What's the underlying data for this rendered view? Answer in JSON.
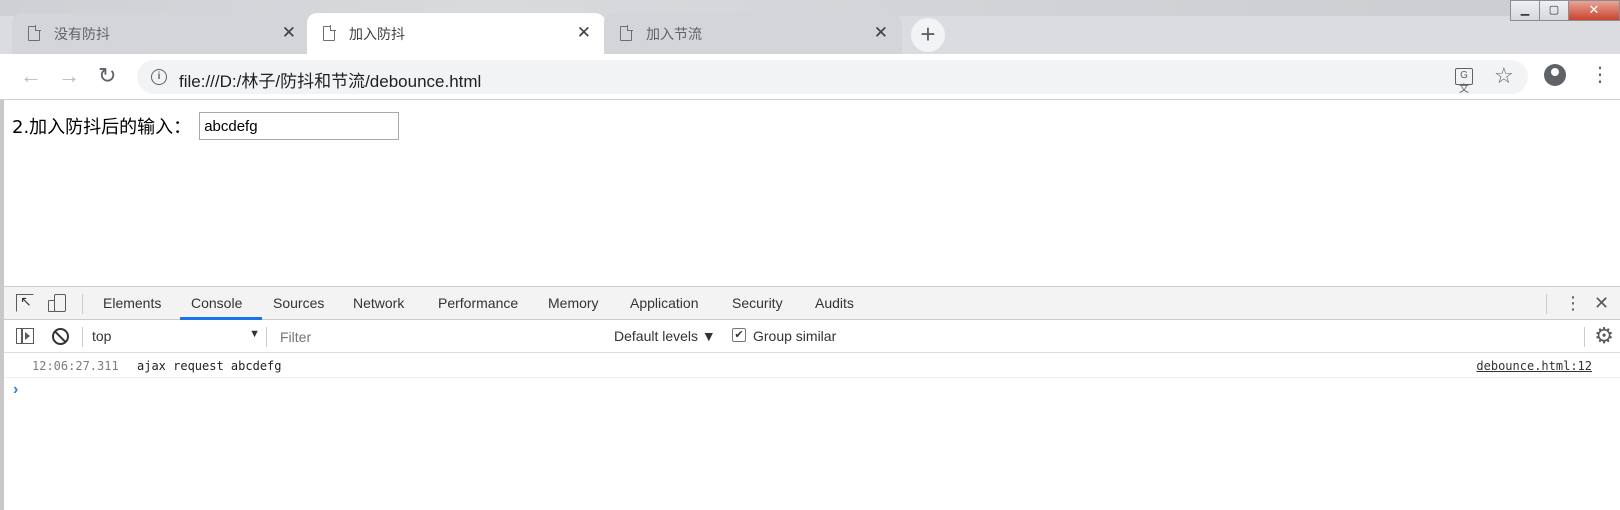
{
  "browser": {
    "tabs": [
      {
        "label": "没有防抖",
        "active": false
      },
      {
        "label": "加入防抖",
        "active": true
      },
      {
        "label": "加入节流",
        "active": false
      }
    ],
    "tab_close_glyph": "✕",
    "new_tab_glyph": "+",
    "window_buttons": {
      "minimize": "▁",
      "maximize": "▢",
      "close": "✕"
    },
    "nav": {
      "back": "←",
      "forward": "→",
      "reload": "↻"
    },
    "address": "file:///D:/林子/防抖和节流/debounce.html",
    "info_glyph": "i",
    "translate_glyph": "G文",
    "star_glyph": "☆",
    "menu_glyph": "⋮"
  },
  "page": {
    "label": "2.加入防抖后的输入：",
    "input_value": "abcdefg"
  },
  "devtools": {
    "tabs": [
      "Elements",
      "Console",
      "Sources",
      "Network",
      "Performance",
      "Memory",
      "Application",
      "Security",
      "Audits"
    ],
    "selected_tab": "Console",
    "more_glyph": "⋮",
    "close_glyph": "✕",
    "context": "top",
    "context_arrow": "▼",
    "filter_placeholder": "Filter",
    "levels": "Default levels ▼",
    "group_similar": "Group similar",
    "group_similar_checked": true,
    "check_glyph": "✔",
    "settings_glyph": "⚙",
    "messages": [
      {
        "time": "12:06:27.311",
        "text": "ajax request abcdefg",
        "source": "debounce.html:12"
      }
    ],
    "prompt_glyph": "›",
    "accent_color": "#1a73e8"
  }
}
